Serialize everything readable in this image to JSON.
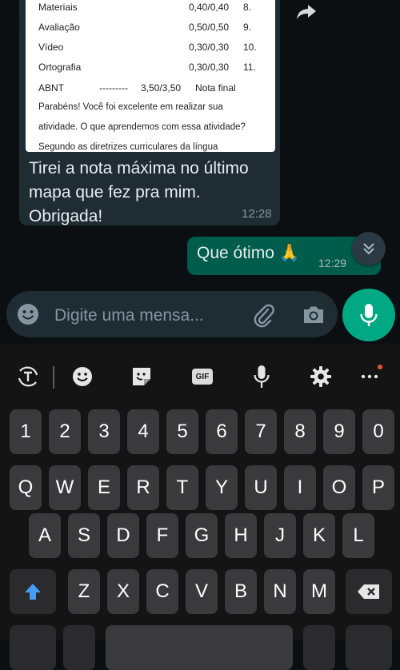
{
  "chat": {
    "incoming": {
      "document": {
        "rows": [
          {
            "label": "Materiais",
            "score": "0,40/0,40",
            "num": "8."
          },
          {
            "label": "Avaliação",
            "score": "0,50/0,50",
            "num": "9."
          },
          {
            "label": "Vídeo",
            "score": "0,30/0,30",
            "num": "10."
          },
          {
            "label": "Ortografia",
            "score": "0,30/0,30",
            "num": "11."
          }
        ],
        "total": {
          "label": "ABNT",
          "dashes": "---------",
          "score": "3,50/3,50",
          "note": "Nota final"
        },
        "paragraph_1": "Parabéns! Você foi excelente em realizar sua",
        "paragraph_2": "atividade.  O que aprendemos com essa atividade?",
        "paragraph_3": "Segundo as diretrizes curriculares da língua"
      },
      "text": "Tirei a nota máxima no último mapa que fez pra mim. Obrigada!",
      "time": "12:28"
    },
    "outgoing": {
      "text": "Que ótimo 🙏",
      "time": "12:29"
    }
  },
  "composer": {
    "placeholder": "Digite uma mensa..."
  },
  "keyboard": {
    "toolbar": {
      "gif_label": "GIF"
    },
    "number_row": [
      "1",
      "2",
      "3",
      "4",
      "5",
      "6",
      "7",
      "8",
      "9",
      "0"
    ],
    "row1": [
      "Q",
      "W",
      "E",
      "R",
      "T",
      "Y",
      "U",
      "I",
      "O",
      "P"
    ],
    "row2": [
      "A",
      "S",
      "D",
      "F",
      "G",
      "H",
      "J",
      "K",
      "L"
    ],
    "row3": [
      "Z",
      "X",
      "C",
      "V",
      "B",
      "N",
      "M"
    ]
  },
  "colors": {
    "accent": "#00a884",
    "outgoing_bubble": "#005c4b",
    "incoming_bubble": "#1f2c34",
    "shift_arrow": "#4a9bf5"
  }
}
